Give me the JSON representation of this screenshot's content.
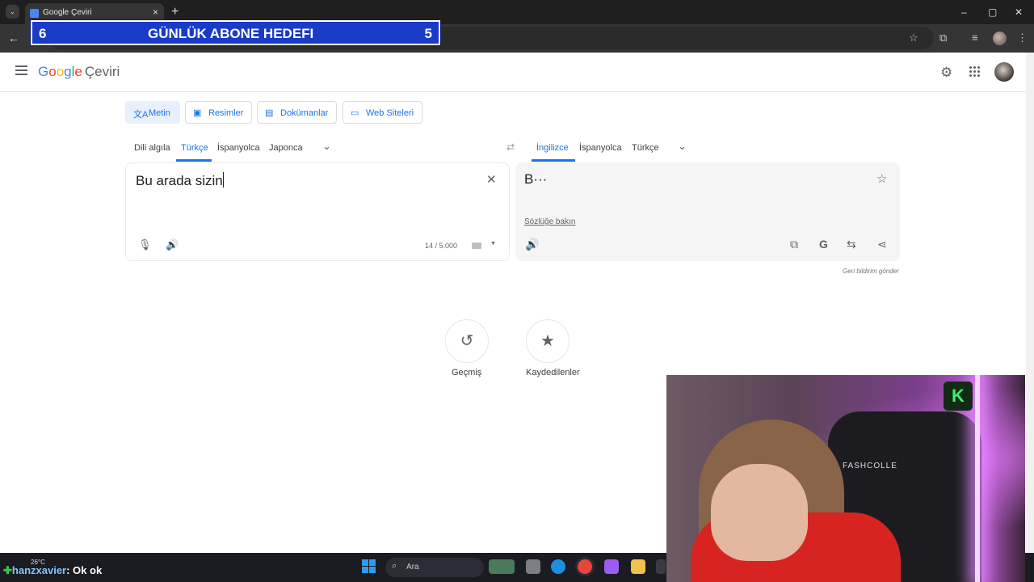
{
  "browser": {
    "tab_title": "Google Çeviri",
    "new_tab": "+",
    "close_tab": "×",
    "window_controls": [
      "–",
      "▢",
      "✕"
    ]
  },
  "overlay": {
    "left_number": "6",
    "title": "GÜNLÜK ABONE HEDEFI",
    "right_number": "5"
  },
  "header": {
    "logo_parts": [
      "G",
      "o",
      "o",
      "g",
      "l",
      "e"
    ],
    "product": "Çeviri"
  },
  "modes": [
    {
      "label": "Metin",
      "icon": "translate-icon",
      "active": true
    },
    {
      "label": "Resimler",
      "icon": "image-icon",
      "active": false
    },
    {
      "label": "Dokümanlar",
      "icon": "document-icon",
      "active": false
    },
    {
      "label": "Web Siteleri",
      "icon": "web-icon",
      "active": false
    }
  ],
  "source_langs": [
    "Dili algıla",
    "Türkçe",
    "İspanyolca",
    "Japonca"
  ],
  "target_langs": [
    "İngilizce",
    "İspanyolca",
    "Türkçe"
  ],
  "source": {
    "text": "Bu arada sizin",
    "count": "14 / 5.000"
  },
  "target": {
    "text": "B···",
    "dictionary_link": "Sözlüğe bakın",
    "feedback": "Geri bildirim gönder"
  },
  "shortcuts": [
    {
      "label": "Geçmiş",
      "icon": "history-icon"
    },
    {
      "label": "Kaydedilenler",
      "icon": "star-icon"
    }
  ],
  "taskbar": {
    "weather": "26°C",
    "chat_user": "hanzxavier",
    "chat_msg": ": Ok ok",
    "search_text": "Ara"
  },
  "webcam": {
    "chair_brand": "FASHCOLLE",
    "logo_letter": "K"
  },
  "colors": {
    "accent": "#1a73e8",
    "overlay_blue": "#1a3bc8"
  }
}
